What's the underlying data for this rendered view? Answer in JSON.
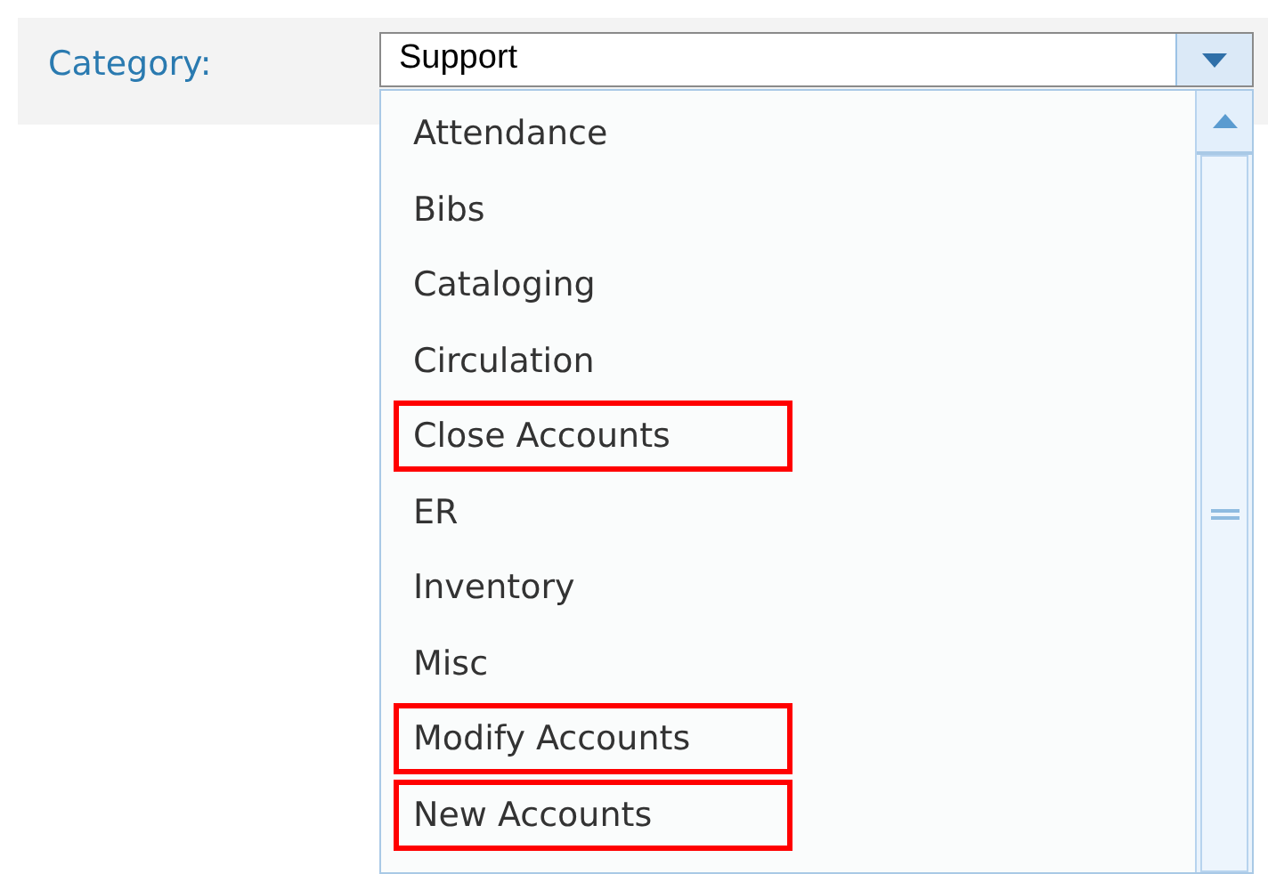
{
  "field": {
    "label": "Category:",
    "value": "Support"
  },
  "options": [
    {
      "label": "Attendance",
      "highlighted": false
    },
    {
      "label": "Bibs",
      "highlighted": false
    },
    {
      "label": "Cataloging",
      "highlighted": false
    },
    {
      "label": "Circulation",
      "highlighted": false
    },
    {
      "label": "Close Accounts",
      "highlighted": true
    },
    {
      "label": "ER",
      "highlighted": false
    },
    {
      "label": "Inventory",
      "highlighted": false
    },
    {
      "label": "Misc",
      "highlighted": false
    },
    {
      "label": "Modify Accounts",
      "highlighted": true
    },
    {
      "label": "New Accounts",
      "highlighted": true
    }
  ]
}
